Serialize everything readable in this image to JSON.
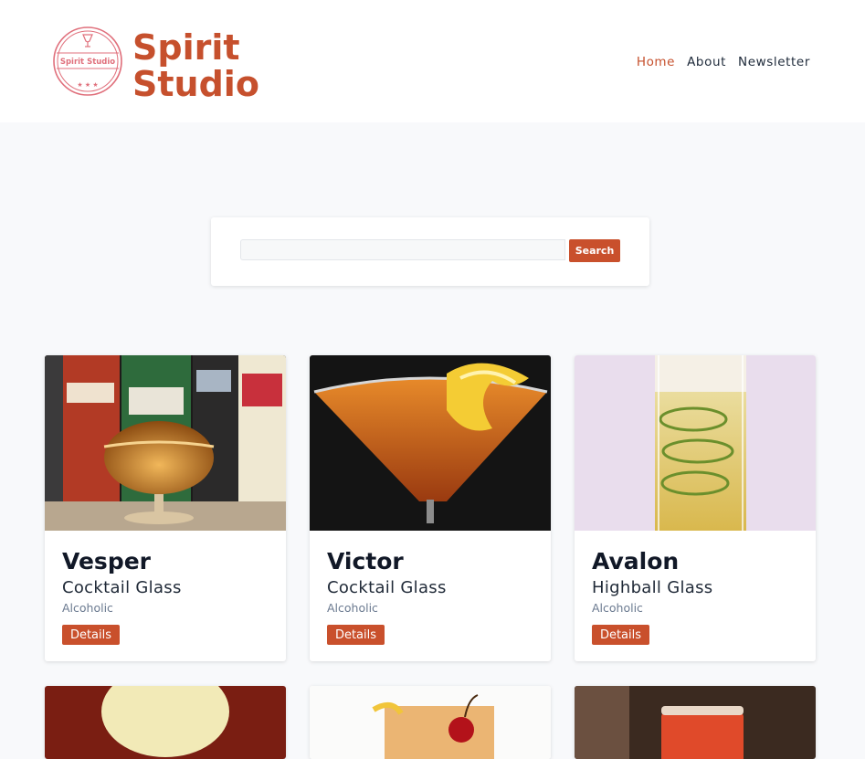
{
  "header": {
    "brand_line1": "Spirit",
    "brand_line2": "Studio",
    "logo_text": "Spirit Studio",
    "nav": [
      {
        "label": "Home",
        "active": true
      },
      {
        "label": "About",
        "active": false
      },
      {
        "label": "Newsletter",
        "active": false
      }
    ]
  },
  "search": {
    "value": "",
    "placeholder": "",
    "button_label": "Search"
  },
  "cards": [
    {
      "name": "Vesper",
      "glass": "Cocktail Glass",
      "category": "Alcoholic",
      "button": "Details",
      "image": "vesper-photo"
    },
    {
      "name": "Victor",
      "glass": "Cocktail Glass",
      "category": "Alcoholic",
      "button": "Details",
      "image": "victor-photo"
    },
    {
      "name": "Avalon",
      "glass": "Highball Glass",
      "category": "Alcoholic",
      "button": "Details",
      "image": "avalon-photo"
    }
  ],
  "colors": {
    "accent": "#c9502c",
    "page_bg": "#f8f9fb",
    "title_text": "#111827",
    "muted_text": "#6b7a90"
  }
}
